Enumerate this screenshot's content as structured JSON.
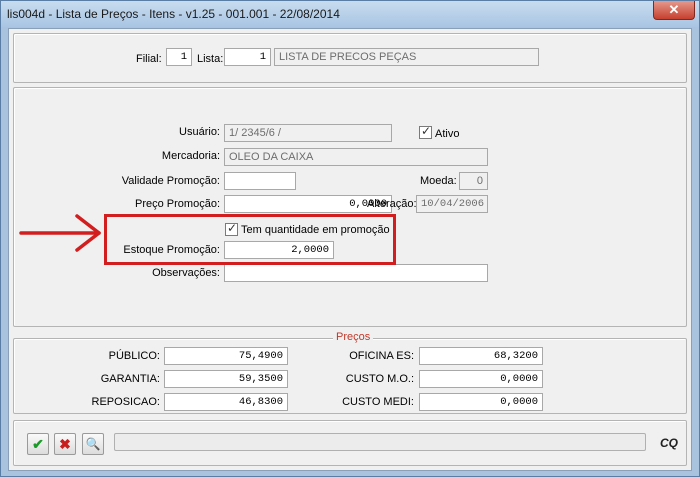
{
  "window": {
    "title": "lis004d - Lista de Preços - Itens - v1.25 - 001.001 - 22/08/2014",
    "close_glyph": "✕"
  },
  "header": {
    "filial_label": "Filial:",
    "filial_value": "1",
    "lista_label": "Lista:",
    "lista_value": "1",
    "lista_desc": "LISTA DE PRECOS PEÇAS"
  },
  "form": {
    "usuario_label": "Usuário:",
    "usuario_value": "1/   2345/6 /",
    "ativo_label": "Ativo",
    "ativo_checked": true,
    "mercadoria_label": "Mercadoria:",
    "mercadoria_value": "OLEO DA CAIXA",
    "validade_label": "Validade Promoção:",
    "validade_value": "",
    "moeda_label": "Moeda:",
    "moeda_value": "0",
    "preco_label": "Preço Promoção:",
    "preco_value": "0,0000",
    "alteracao_label": "Alteração:",
    "alteracao_value": "10/04/2006",
    "tem_qtd_label": "Tem quantidade em promoção",
    "tem_qtd_checked": true,
    "estoque_label": "Estoque Promoção:",
    "estoque_value": "2,0000",
    "observacoes_label": "Observações:",
    "observacoes_value": ""
  },
  "precos": {
    "legend": "Preços",
    "publico_label": "PÚBLICO:",
    "publico_value": "75,4900",
    "garantia_label": "GARANTIA:",
    "garantia_value": "59,3500",
    "reposicao_label": "REPOSICAO:",
    "reposicao_value": "46,8300",
    "oficina_label": "OFICINA ES:",
    "oficina_value": "68,3200",
    "custo_mo_label": "CUSTO M.O.:",
    "custo_mo_value": "0,0000",
    "custo_medi_label": "CUSTO MEDI:",
    "custo_medi_value": "0,0000"
  },
  "toolbar": {
    "confirm_glyph": "✔",
    "cancel_glyph": "✖",
    "search_glyph": "🔍",
    "status_text": "",
    "logo": "CQ"
  },
  "colors": {
    "accent_red": "#d21e1e",
    "confirm_green": "#1e9a2a",
    "cancel_red": "#c81e1e"
  }
}
